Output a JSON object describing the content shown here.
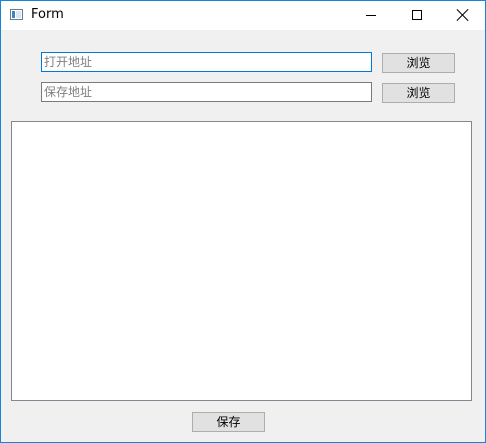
{
  "window": {
    "title": "Form",
    "controls": [
      "minimize-icon",
      "maximize-icon",
      "close-icon"
    ]
  },
  "form": {
    "open_path": {
      "value": "",
      "placeholder": "打开地址"
    },
    "save_path": {
      "value": "",
      "placeholder": "保存地址"
    },
    "browse_open_label": "浏览",
    "browse_save_label": "浏览",
    "content_text": "",
    "save_label": "保存"
  },
  "colors": {
    "window_border": "#1883d7",
    "focus_border": "#0078d7",
    "background": "#f0f0f0",
    "button_bg": "#e1e1e1"
  }
}
